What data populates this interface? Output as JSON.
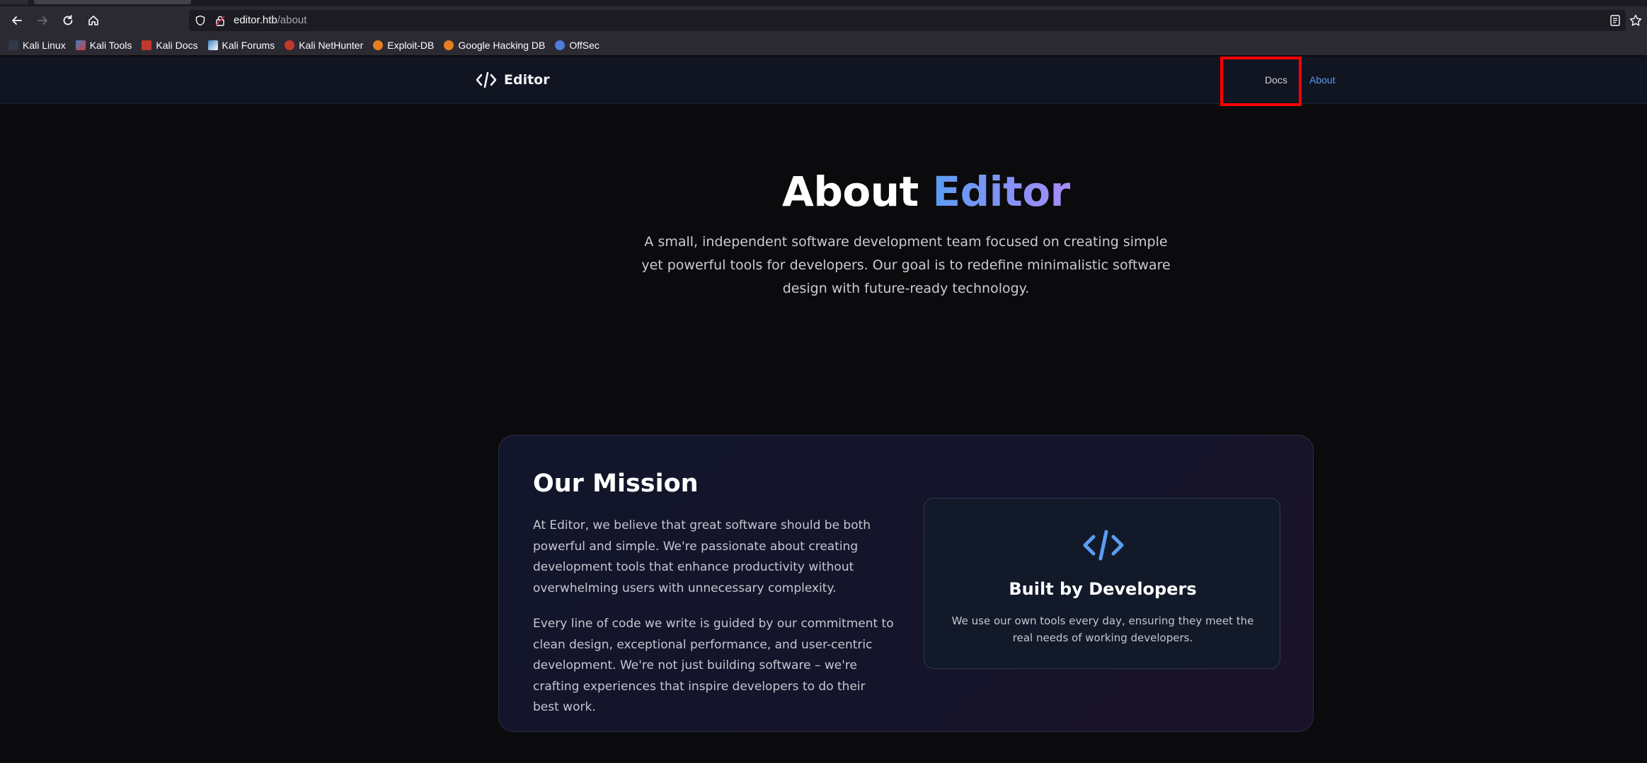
{
  "browser": {
    "url_host": "editor.htb",
    "url_path": "/about",
    "bookmarks": [
      {
        "label": "Kali Linux",
        "icon": "kali-linux-icon",
        "color": "#2f3a4a"
      },
      {
        "label": "Kali Tools",
        "icon": "kali-tools-icon",
        "color": "#d33b3b"
      },
      {
        "label": "Kali Docs",
        "icon": "kali-docs-icon",
        "color": "#c0392b"
      },
      {
        "label": "Kali Forums",
        "icon": "kali-forums-icon",
        "color": "#3b82c4"
      },
      {
        "label": "Kali NetHunter",
        "icon": "kali-nethunter-icon",
        "color": "#c0392b"
      },
      {
        "label": "Exploit-DB",
        "icon": "exploit-db-icon",
        "color": "#e67e22"
      },
      {
        "label": "Google Hacking DB",
        "icon": "google-hacking-db-icon",
        "color": "#e67e22"
      },
      {
        "label": "OffSec",
        "icon": "offsec-icon",
        "color": "#4f7bd9"
      }
    ]
  },
  "site": {
    "brand": "Editor",
    "nav": {
      "docs": "Docs",
      "about": "About"
    },
    "accent_color": "#5b9cf2"
  },
  "hero": {
    "title_prefix": "About",
    "title_accent": "Editor",
    "subtitle": "A small, independent software development team focused on creating simple yet powerful tools for developers. Our goal is to redefine minimalistic software design with future-ready technology."
  },
  "mission": {
    "title": "Our Mission",
    "paragraph1": "At Editor, we believe that great software should be both powerful and simple. We're passionate about creating development tools that enhance productivity without overwhelming users with unnecessary complexity.",
    "paragraph2": "Every line of code we write is guided by our commitment to clean design, exceptional performance, and user-centric development. We're not just building software – we're crafting experiences that inspire developers to do their best work.",
    "card": {
      "title": "Built by Developers",
      "text": "We use our own tools every day, ensuring they meet the real needs of working developers."
    }
  }
}
